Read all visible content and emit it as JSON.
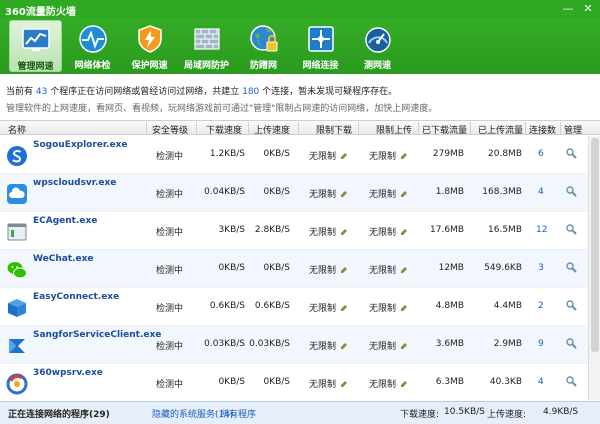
{
  "window": {
    "title": "360流量防火墙",
    "minimize": "—",
    "close": "✕"
  },
  "toolbar": [
    {
      "label": "管理网速",
      "icon": "monitor-graph-icon",
      "active": true
    },
    {
      "label": "网络体检",
      "icon": "pulse-icon",
      "active": false
    },
    {
      "label": "保护网速",
      "icon": "shield-bolt-icon",
      "active": false
    },
    {
      "label": "局域网防护",
      "icon": "brick-wall-icon",
      "active": false
    },
    {
      "label": "防蹭网",
      "icon": "globe-lock-icon",
      "active": false
    },
    {
      "label": "网络连接",
      "icon": "network-connection-icon",
      "active": false
    },
    {
      "label": "测网速",
      "icon": "speedometer-icon",
      "active": false
    }
  ],
  "info": {
    "prefix": "当前有",
    "program_count": "43",
    "mid": "个程序正在访问网络或曾经访问过网络，共建立",
    "connection_count": "180",
    "suffix": "个连接，暂未发现可疑程序存在。",
    "hint": "管理软件的上网速度，看网页、看视频，玩网络游戏前可通过\"管理\"限制占网速的访问网络，加快上网速度。"
  },
  "columns": [
    "名称",
    "安全等级",
    "下载速度",
    "上传速度",
    "限制下载",
    "限制上传",
    "已下载流量",
    "已上传流量",
    "连接数",
    "管理"
  ],
  "rows": [
    {
      "name": "SogouExplorer.exe",
      "icon": "sogou-icon",
      "security": "检测中",
      "down": "1.2KB/S",
      "up": "0KB/S",
      "limit_down": "无限制",
      "limit_up": "无限制",
      "downloaded": "279MB",
      "uploaded": "20.8MB",
      "connections": "6"
    },
    {
      "name": "wpscloudsvr.exe",
      "icon": "cloud-icon",
      "security": "检测中",
      "down": "0.04KB/S",
      "up": "0KB/S",
      "limit_down": "无限制",
      "limit_up": "无限制",
      "downloaded": "1.8MB",
      "uploaded": "168.3MB",
      "connections": "4"
    },
    {
      "name": "ECAgent.exe",
      "icon": "window-app-icon",
      "security": "检测中",
      "down": "3KB/S",
      "up": "2.8KB/S",
      "limit_down": "无限制",
      "limit_up": "无限制",
      "downloaded": "17.6MB",
      "uploaded": "16.5MB",
      "connections": "12"
    },
    {
      "name": "WeChat.exe",
      "icon": "wechat-icon",
      "security": "检测中",
      "down": "0KB/S",
      "up": "0KB/S",
      "limit_down": "无限制",
      "limit_up": "无限制",
      "downloaded": "12MB",
      "uploaded": "549.6KB",
      "connections": "3"
    },
    {
      "name": "EasyConnect.exe",
      "icon": "easyconnect-icon",
      "security": "检测中",
      "down": "0.6KB/S",
      "up": "0.6KB/S",
      "limit_down": "无限制",
      "limit_up": "无限制",
      "downloaded": "4.8MB",
      "uploaded": "4.4MB",
      "connections": "2"
    },
    {
      "name": "SangforServiceClient.exe",
      "icon": "sangfor-icon",
      "security": "检测中",
      "down": "0.03KB/S",
      "up": "0.03KB/S",
      "limit_down": "无限制",
      "limit_up": "无限制",
      "downloaded": "3.6MB",
      "uploaded": "2.9MB",
      "connections": "9"
    },
    {
      "name": "360wpsrv.exe",
      "icon": "360-icon",
      "security": "检测中",
      "down": "0KB/S",
      "up": "0KB/S",
      "limit_down": "无限制",
      "limit_up": "无限制",
      "downloaded": "6.3MB",
      "uploaded": "40.3KB",
      "connections": "4"
    }
  ],
  "status": {
    "active_tab": "正在连接网络的程序(29)",
    "hidden_tab": "隐藏的系统服务(14)",
    "all_tab": "所有程序",
    "down_label": "下载速度:",
    "down_value": "10.5KB/S",
    "up_label": "上传速度:",
    "up_value": "4.9KB/S"
  },
  "colors": {
    "accent": "#2fa822",
    "link": "#1a5fc0",
    "name": "#1b4d9c"
  }
}
